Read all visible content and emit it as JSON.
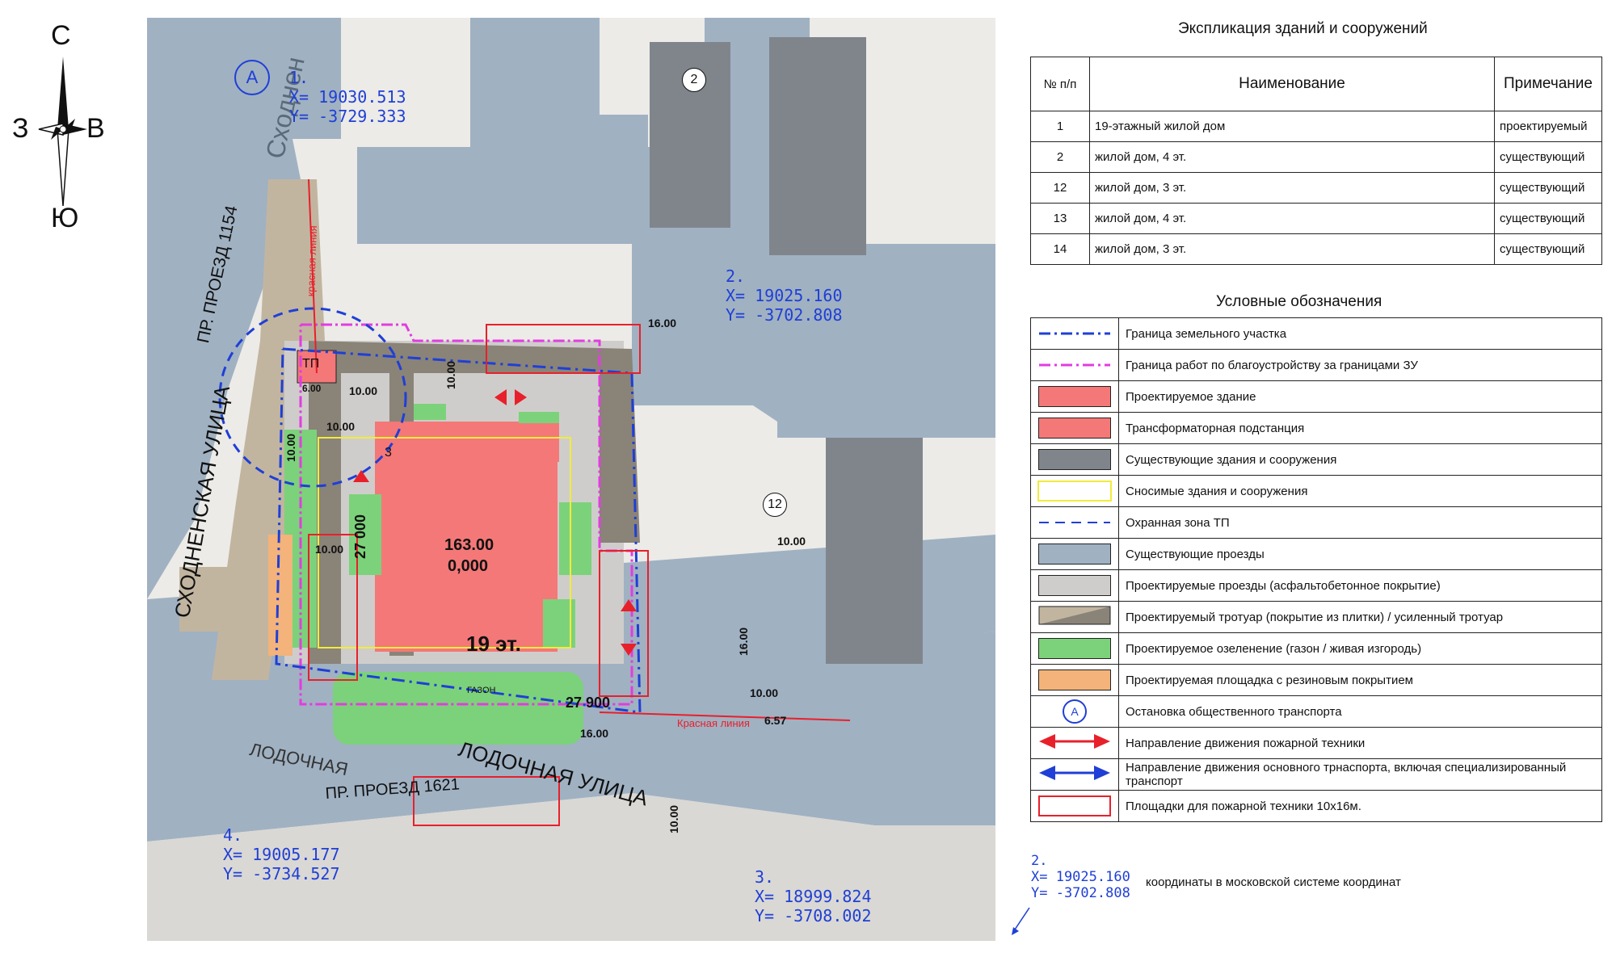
{
  "compass": {
    "north": "С",
    "south": "Ю",
    "west": "З",
    "east": "В"
  },
  "map": {
    "streets": [
      {
        "label": "СХОДНЕНСКАЯ  УЛИЦА"
      },
      {
        "label": "ПР. ПРОЕЗД 1154"
      },
      {
        "label": "ЛОДОЧНАЯ  УЛИЦА"
      },
      {
        "label": "ПР. ПРОЕЗД 1621"
      },
      {
        "label": "ЛОДОЧНАЯ"
      },
      {
        "label": "Сходнен"
      }
    ],
    "labels": {
      "building_area": "163.00",
      "zero_level": "0,000",
      "floors": "19 эт.",
      "tp": "ТП",
      "red_line_1": "красная линия",
      "red_line_2": "Красная линия",
      "gazon": "ГАЗОН",
      "building_2": "2",
      "building_12": "12",
      "stop": "A",
      "zone_mark": "3"
    },
    "dimensions": [
      "16.00",
      "10.00",
      "10.00",
      "10.00",
      "6.00",
      "10.00",
      "27 000",
      "27 900",
      "16.00",
      "10.00",
      "10.00",
      "16.00",
      "10.00",
      "6.57",
      "10.00"
    ],
    "coordinates": [
      {
        "num": "1.",
        "x": "X= 19030.513",
        "y": "Y= -3729.333"
      },
      {
        "num": "2.",
        "x": "X= 19025.160",
        "y": "Y= -3702.808"
      },
      {
        "num": "3.",
        "x": "X= 18999.824",
        "y": "Y= -3708.002"
      },
      {
        "num": "4.",
        "x": "X= 19005.177",
        "y": "Y= -3734.527"
      }
    ]
  },
  "explication": {
    "title": "Экспликация зданий и сооружений",
    "headers": [
      "№ п/п",
      "Наименование",
      "Примечание"
    ],
    "rows": [
      {
        "num": "1",
        "name": "19-этажный жилой дом",
        "note": "проектируемый"
      },
      {
        "num": "2",
        "name": "жилой дом, 4 эт.",
        "note": "существующий"
      },
      {
        "num": "12",
        "name": "жилой дом, 3 эт.",
        "note": "существующий"
      },
      {
        "num": "13",
        "name": "жилой дом, 4 эт.",
        "note": "существующий"
      },
      {
        "num": "14",
        "name": "жилой дом, 3 эт.",
        "note": "существующий"
      }
    ]
  },
  "legend": {
    "title": "Условные обозначения",
    "items": [
      {
        "label": "Граница земельного участка",
        "symbol": "dashdot-blue-line"
      },
      {
        "label": "Граница работ по благоустройству за границами ЗУ",
        "symbol": "dashdot-magenta-line"
      },
      {
        "label": "Проектируемое здание",
        "symbol": "red-fill",
        "color": "#f47878"
      },
      {
        "label": "Трансформаторная подстанция",
        "symbol": "red-fill",
        "color": "#f47878"
      },
      {
        "label": "Существующие здания и сооружения",
        "symbol": "gray-fill",
        "color": "#80858c"
      },
      {
        "label": "Сносимые здания и сооружения",
        "symbol": "yellow-outline",
        "color": "#f2ec3c"
      },
      {
        "label": "Охранная зона ТП",
        "symbol": "dash-blue-line"
      },
      {
        "label": "Существующие проезды",
        "symbol": "blue-gray-fill",
        "color": "#a0b1c2"
      },
      {
        "label": "Проектируемые проезды (асфальтобетонное покрытие)",
        "symbol": "light-gray-fill",
        "color": "#cfcdcb"
      },
      {
        "label": "Проектируемый тротуар (покрытие из плитки) / усиленный тротуар",
        "symbol": "tan-split",
        "color": "#c2b5a0"
      },
      {
        "label": "Проектируемое озеленение (газон / живая изгородь)",
        "symbol": "green-fill",
        "color": "#7cd27a"
      },
      {
        "label": "Проектируемая площадка с резиновым покрытием",
        "symbol": "orange-fill",
        "color": "#f3b37a"
      },
      {
        "label": "Остановка общественного транспорта",
        "symbol": "bus-stop-icon",
        "text": "A"
      },
      {
        "label": "Направление движения пожарной техники",
        "symbol": "red-arrow-icon"
      },
      {
        "label": "Направление движения основного трнаспорта, включая специализированный транспорт",
        "symbol": "blue-arrow-icon"
      },
      {
        "label": "Площадки для пожарной техники 10х16м.",
        "symbol": "red-outline"
      }
    ]
  },
  "note": {
    "num": "2.",
    "x": "X= 19025.160",
    "y": "Y= -3702.808",
    "text": "координаты в московской системе координат"
  },
  "colors": {
    "existing_roads": "#a0b1c2",
    "projected_building": "#f47878",
    "existing_buildings": "#80858c",
    "green": "#7cd27a",
    "sidewalk": "#c2b5a0",
    "coord_blue": "#1f3fd6",
    "fire_red": "#e8202a",
    "boundary_magenta": "#e23ce0"
  }
}
